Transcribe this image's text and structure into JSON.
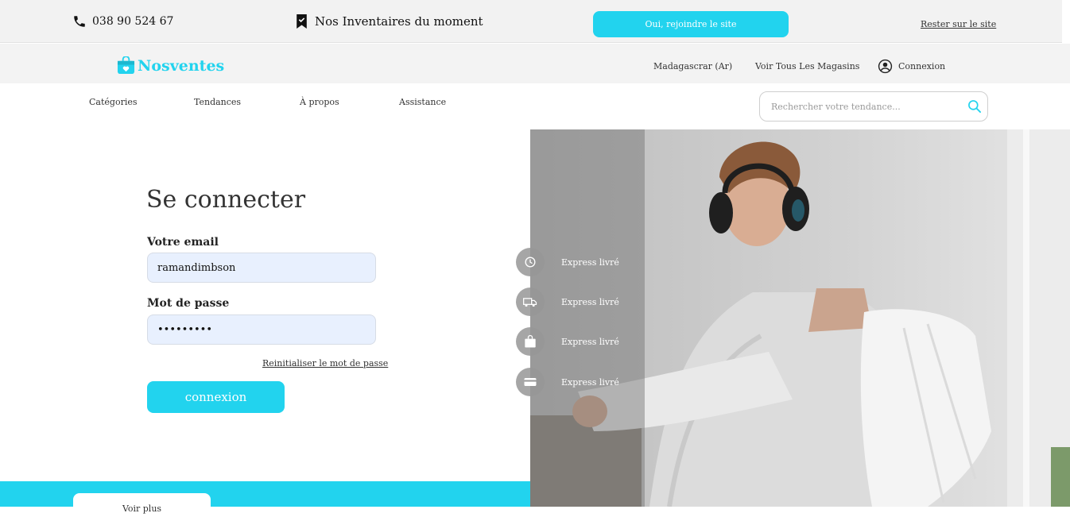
{
  "topbar": {
    "phone": "038 90 524 67",
    "inventories": "Nos Inventaires du moment",
    "join_button": "Oui, rejoindre le site",
    "stay_link": "Rester sur le site"
  },
  "header": {
    "brand": "Nosventes",
    "country": "Madagascrar (Ar)",
    "stores": "Voir Tous Les Magasins",
    "login": "Connexion"
  },
  "nav": {
    "items": [
      "Catégories",
      "Tendances",
      "À propos",
      "Assistance"
    ],
    "search_placeholder": "Rechercher votre tendance..."
  },
  "login_form": {
    "title": "Se connecter",
    "email_label": "Votre email",
    "email_value": "ramandimbson",
    "password_label": "Mot de passe",
    "password_value": "123456789",
    "reset_link": "Reinitialiser le mot de passe",
    "submit": "connexion"
  },
  "features": [
    {
      "icon": "express-delivery-icon",
      "label": "Express livré"
    },
    {
      "icon": "truck-icon",
      "label": "Express livré"
    },
    {
      "icon": "shopping-bag-icon",
      "label": "Express livré"
    },
    {
      "icon": "credit-card-icon",
      "label": "Express livré"
    }
  ],
  "footer_band": {
    "more_button": "Voir plus"
  },
  "colors": {
    "accent": "#22d3ee",
    "topbar_bg": "#f2f2f2",
    "input_bg": "#e8f0fe"
  }
}
